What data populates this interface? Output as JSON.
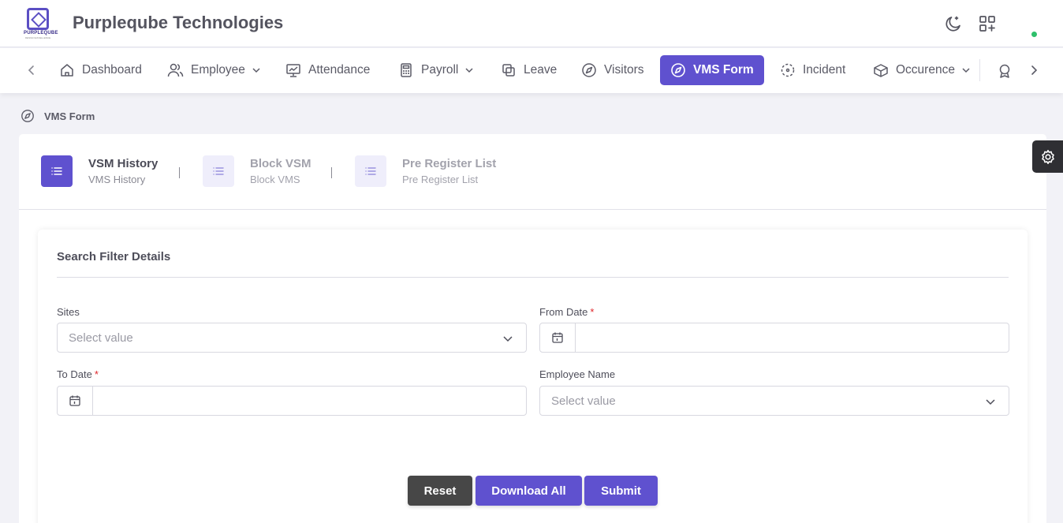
{
  "header": {
    "company_name": "Purpleqube Technologies",
    "logo_text": "PURPLEQUBE",
    "logo_sub": "DESIGN EXCELLENCE"
  },
  "nav": {
    "items": [
      {
        "label": "Dashboard"
      },
      {
        "label": "Employee"
      },
      {
        "label": "Attendance"
      },
      {
        "label": "Payroll"
      },
      {
        "label": "Leave"
      },
      {
        "label": "Visitors"
      },
      {
        "label": "VMS Form"
      },
      {
        "label": "Incident"
      },
      {
        "label": "Occurence"
      }
    ],
    "active": "VMS Form"
  },
  "breadcrumb": {
    "label": "VMS Form"
  },
  "tabs": [
    {
      "title": "VSM History",
      "sub": "VMS History"
    },
    {
      "title": "Block VSM",
      "sub": "Block VMS"
    },
    {
      "title": "Pre Register List",
      "sub": "Pre Register List"
    }
  ],
  "filter": {
    "title": "Search Filter Details",
    "sites_label": "Sites",
    "sites_placeholder": "Select value",
    "from_date_label": "From Date",
    "to_date_label": "To Date",
    "employee_label": "Employee Name",
    "employee_placeholder": "Select value",
    "required_mark": "*"
  },
  "buttons": {
    "reset": "Reset",
    "download": "Download All",
    "submit": "Submit"
  },
  "colors": {
    "accent": "#5f51cf",
    "reset": "#474747",
    "online": "#2ec06b"
  }
}
